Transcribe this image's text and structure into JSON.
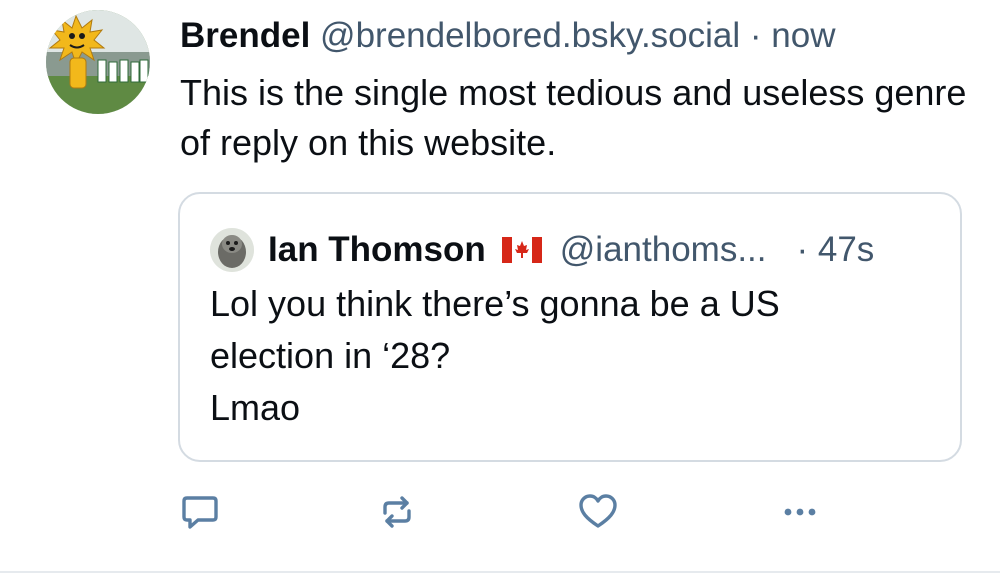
{
  "post": {
    "author_name": "Brendel",
    "handle": "@brendelbored.bsky.social",
    "separator": "·",
    "time": "now",
    "text": "This is the single most tedious and useless genre of reply on this website."
  },
  "quote": {
    "author_name": "Ian Thomson",
    "flag": "🇨🇦",
    "handle": "@ianthoms...",
    "time": "· 47s",
    "text": "Lol you think there’s gonna be a US\nelection in ‘28?\nLmao"
  },
  "actions": [
    {
      "icon": "reply-icon"
    },
    {
      "icon": "repost-icon"
    },
    {
      "icon": "like-icon"
    },
    {
      "icon": "more-options-icon"
    }
  ],
  "colors": {
    "text": "#0b0f14",
    "secondary": "#42576c",
    "border": "#d4dbe2",
    "icon": "#5b7fa3"
  }
}
